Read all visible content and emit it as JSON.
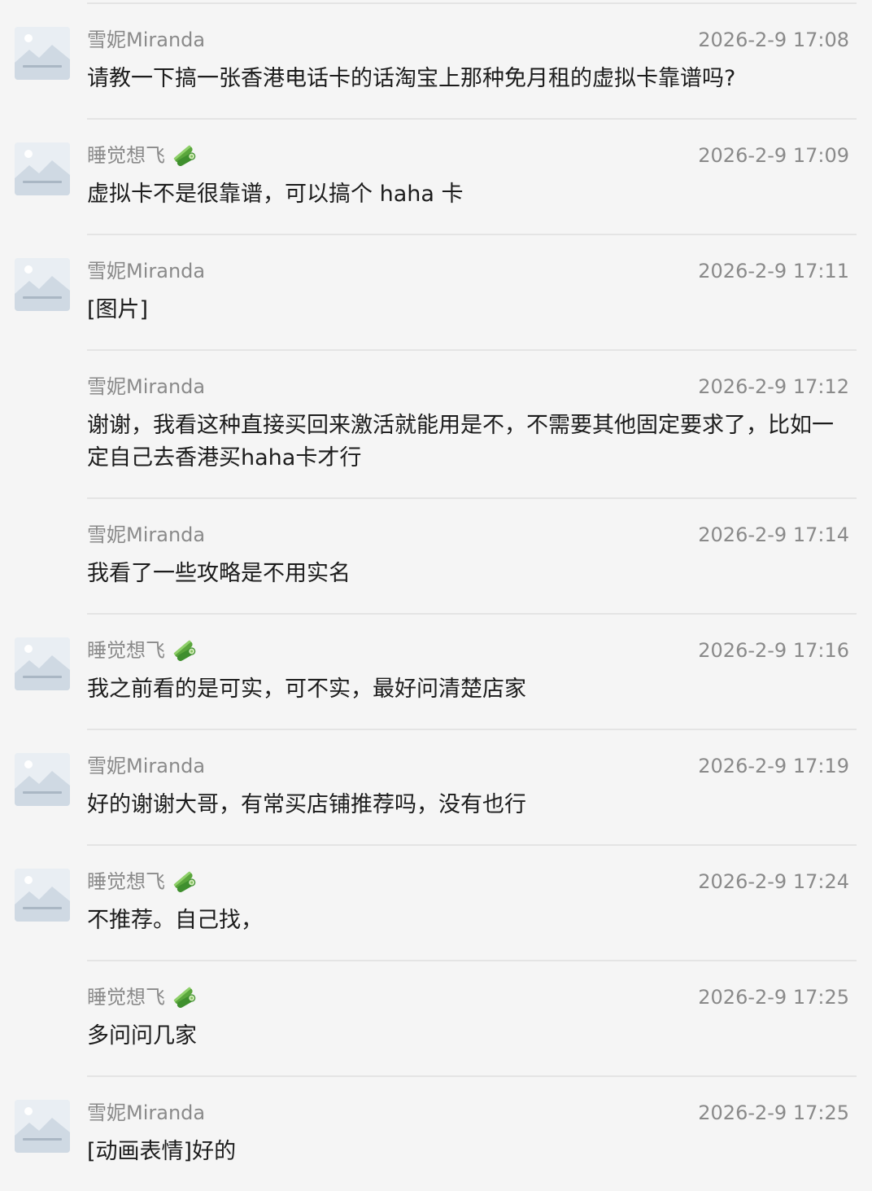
{
  "messages": [
    {
      "sender": "雪妮Miranda",
      "time": "2026-2-9 17:08",
      "text": "请教一下搞一张香港电话卡的话淘宝上那种免月租的虚拟卡靠谱吗?",
      "avatar": true,
      "badge": false
    },
    {
      "sender": "睡觉想飞",
      "time": "2026-2-9 17:09",
      "text": "虚拟卡不是很靠谱，可以搞个 haha 卡",
      "avatar": true,
      "badge": true
    },
    {
      "sender": "雪妮Miranda",
      "time": "2026-2-9 17:11",
      "text": "[图片]",
      "avatar": true,
      "badge": false
    },
    {
      "sender": "雪妮Miranda",
      "time": "2026-2-9 17:12",
      "text": "谢谢，我看这种直接买回来激活就能用是不，不需要其他固定要求了，比如一定自己去香港买haha卡才行",
      "avatar": false,
      "badge": false
    },
    {
      "sender": "雪妮Miranda",
      "time": "2026-2-9 17:14",
      "text": "我看了一些攻略是不用实名",
      "avatar": false,
      "badge": false
    },
    {
      "sender": "睡觉想飞",
      "time": "2026-2-9 17:16",
      "text": "我之前看的是可实，可不实，最好问清楚店家",
      "avatar": true,
      "badge": true
    },
    {
      "sender": "雪妮Miranda",
      "time": "2026-2-9 17:19",
      "text": "好的谢谢大哥，有常买店铺推荐吗，没有也行",
      "avatar": true,
      "badge": false
    },
    {
      "sender": "睡觉想飞",
      "time": "2026-2-9 17:24",
      "text": "不推荐。自己找，",
      "avatar": true,
      "badge": true
    },
    {
      "sender": "睡觉想飞",
      "time": "2026-2-9 17:25",
      "text": "多问问几家",
      "avatar": false,
      "badge": true
    },
    {
      "sender": "雪妮Miranda",
      "time": "2026-2-9 17:25",
      "text": "[动画表情]好的",
      "avatar": true,
      "badge": false
    }
  ]
}
